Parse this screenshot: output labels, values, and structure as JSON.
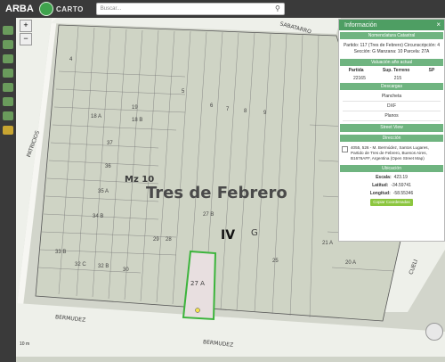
{
  "header": {
    "brand": "ARBA",
    "carto": "CARTO",
    "search_placeholder": "Buscar..."
  },
  "colors": {
    "topbar": "#3a3a3a",
    "accent": "#4e9e63",
    "button": "#8cc63f"
  },
  "panel": {
    "title": "Información",
    "nomenclatura_title": "Nomenclatura Catastral",
    "nomenclatura": "Partido: 117 (Tres de Febrero) Circunscripción: 4 Sección: G Manzana: 10 Parcela: 27A",
    "valuacion_title": "Valuación año actual",
    "valuacion_headers": [
      "Partida",
      "Sup. Terreno",
      "SP"
    ],
    "valuacion_values": [
      "22165",
      "215",
      ""
    ],
    "descargas_title": "Descargas",
    "descargas": [
      "Plancheta",
      "DXF",
      "Planos"
    ],
    "street_view": "Street View",
    "direccion_title": "Dirección",
    "direccion": "4055, 526 - M. Bermúdez, Santos Lugares, Partido de Tres de Febrero, Buenos Aires, B1676AFF, Argentina (Open Street Map)",
    "ubicacion_title": "Ubicación",
    "escala_label": "Escala:",
    "escala_value": "423.19",
    "latitud_label": "Latitud:",
    "latitud_value": "-34.59741",
    "longitud_label": "Longitud:",
    "longitud_value": "-58.55346",
    "copy_button": "Copiar Coordenadas"
  },
  "map": {
    "partido_label": "Tres de Febrero",
    "manzana_label": "Mz 10",
    "circunscripcion": "IV",
    "seccion": "G",
    "parcela_label": "27 A",
    "streets": [
      "SABATARRO",
      "PATRICIOS",
      "BERMUDEZ",
      "BERMUDEZ",
      "CUELI"
    ],
    "lot_labels": [
      "19",
      "18 A",
      "18 B",
      "37",
      "36",
      "35 A",
      "34 B",
      "33 B",
      "32 C",
      "32 B",
      "30",
      "29",
      "28",
      "27 B",
      "25",
      "21 A",
      "20 A",
      "5",
      "6",
      "7",
      "8",
      "9"
    ],
    "scale_label": "10 m"
  }
}
